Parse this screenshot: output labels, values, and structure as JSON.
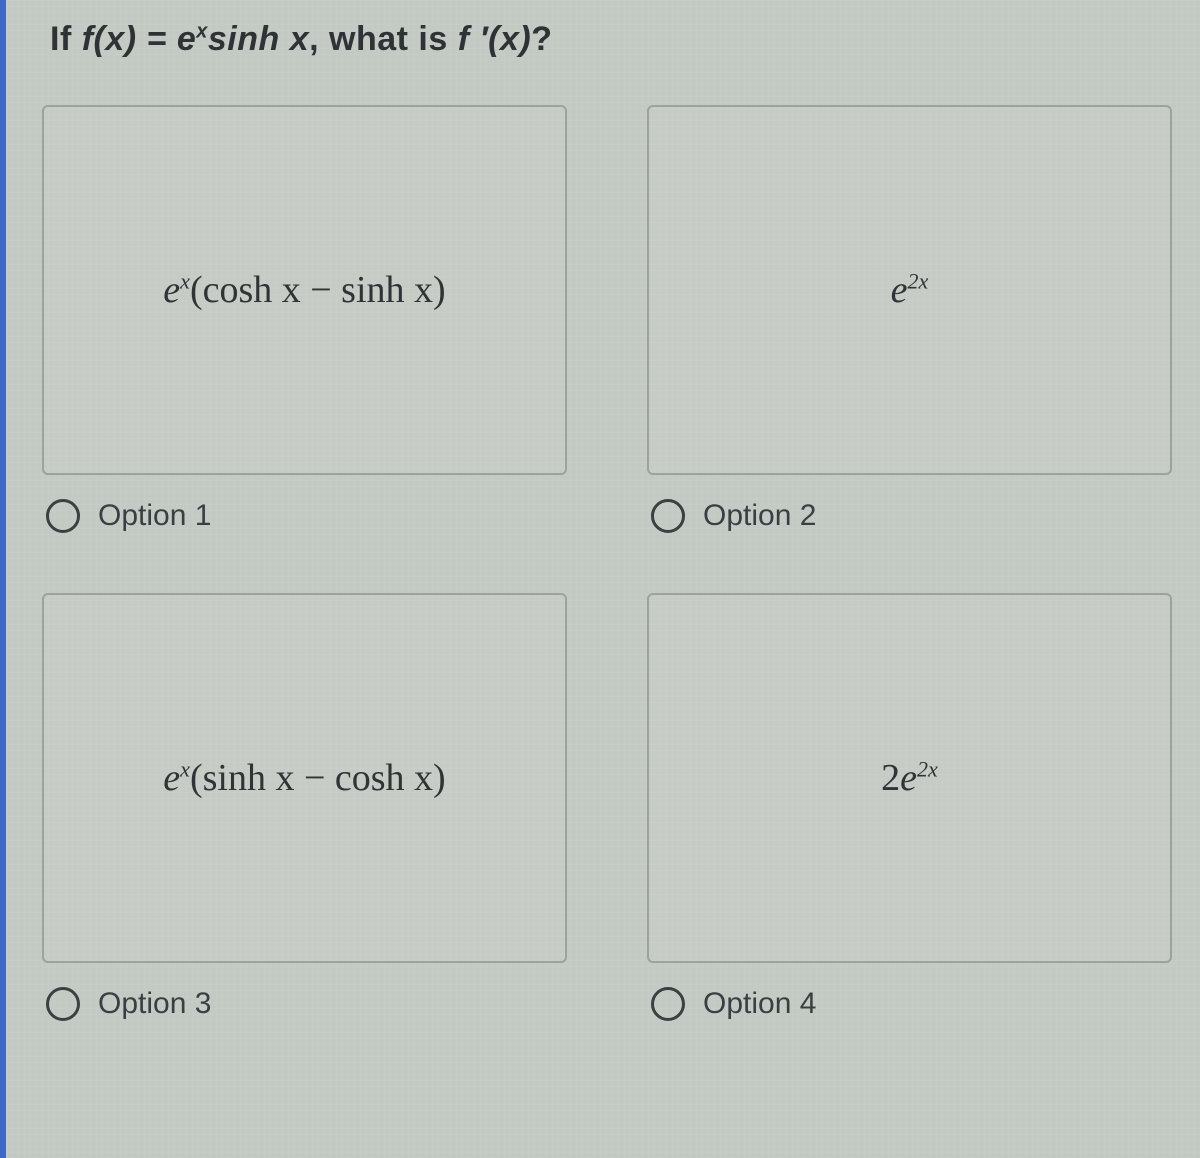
{
  "question": {
    "prefix": "If ",
    "fx": "f(x) = e",
    "sup1": "x",
    "mid": "sinh x",
    "comma": ", what is ",
    "fprime": "f ′(x)",
    "qmark": "?"
  },
  "options": {
    "opt1": {
      "label": "Option 1",
      "seg_a": "e",
      "seg_sup": "x",
      "seg_b": "(cosh x − sinh x)"
    },
    "opt2": {
      "label": "Option 2",
      "seg_a": "e",
      "seg_sup": "2x",
      "seg_b": ""
    },
    "opt3": {
      "label": "Option 3",
      "seg_a": "e",
      "seg_sup": "x",
      "seg_b": "(sinh x − cosh x)"
    },
    "opt4": {
      "label": "Option 4",
      "seg_pre": "2",
      "seg_a": "e",
      "seg_sup": "2x",
      "seg_b": ""
    }
  }
}
